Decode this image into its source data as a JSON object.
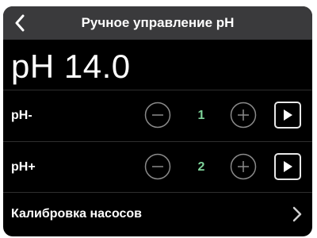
{
  "header": {
    "title": "Ручное управление pH",
    "back_icon": "chevron-left-icon"
  },
  "display": {
    "ph_reading": "pH 14.0"
  },
  "pumps": [
    {
      "label": "pH-",
      "value": "1",
      "minus_icon": "minus-circle-icon",
      "plus_icon": "plus-circle-icon",
      "run_icon": "play-icon"
    },
    {
      "label": "pH+",
      "value": "2",
      "minus_icon": "minus-circle-icon",
      "plus_icon": "plus-circle-icon",
      "run_icon": "play-icon"
    }
  ],
  "calibration": {
    "label": "Калибровка насосов",
    "icon": "chevron-right-icon"
  },
  "colors": {
    "background": "#000000",
    "header": "#3a3a3c",
    "text": "#ffffff",
    "value_accent": "#7ed39a",
    "button_outline": "#8a8a8a"
  }
}
